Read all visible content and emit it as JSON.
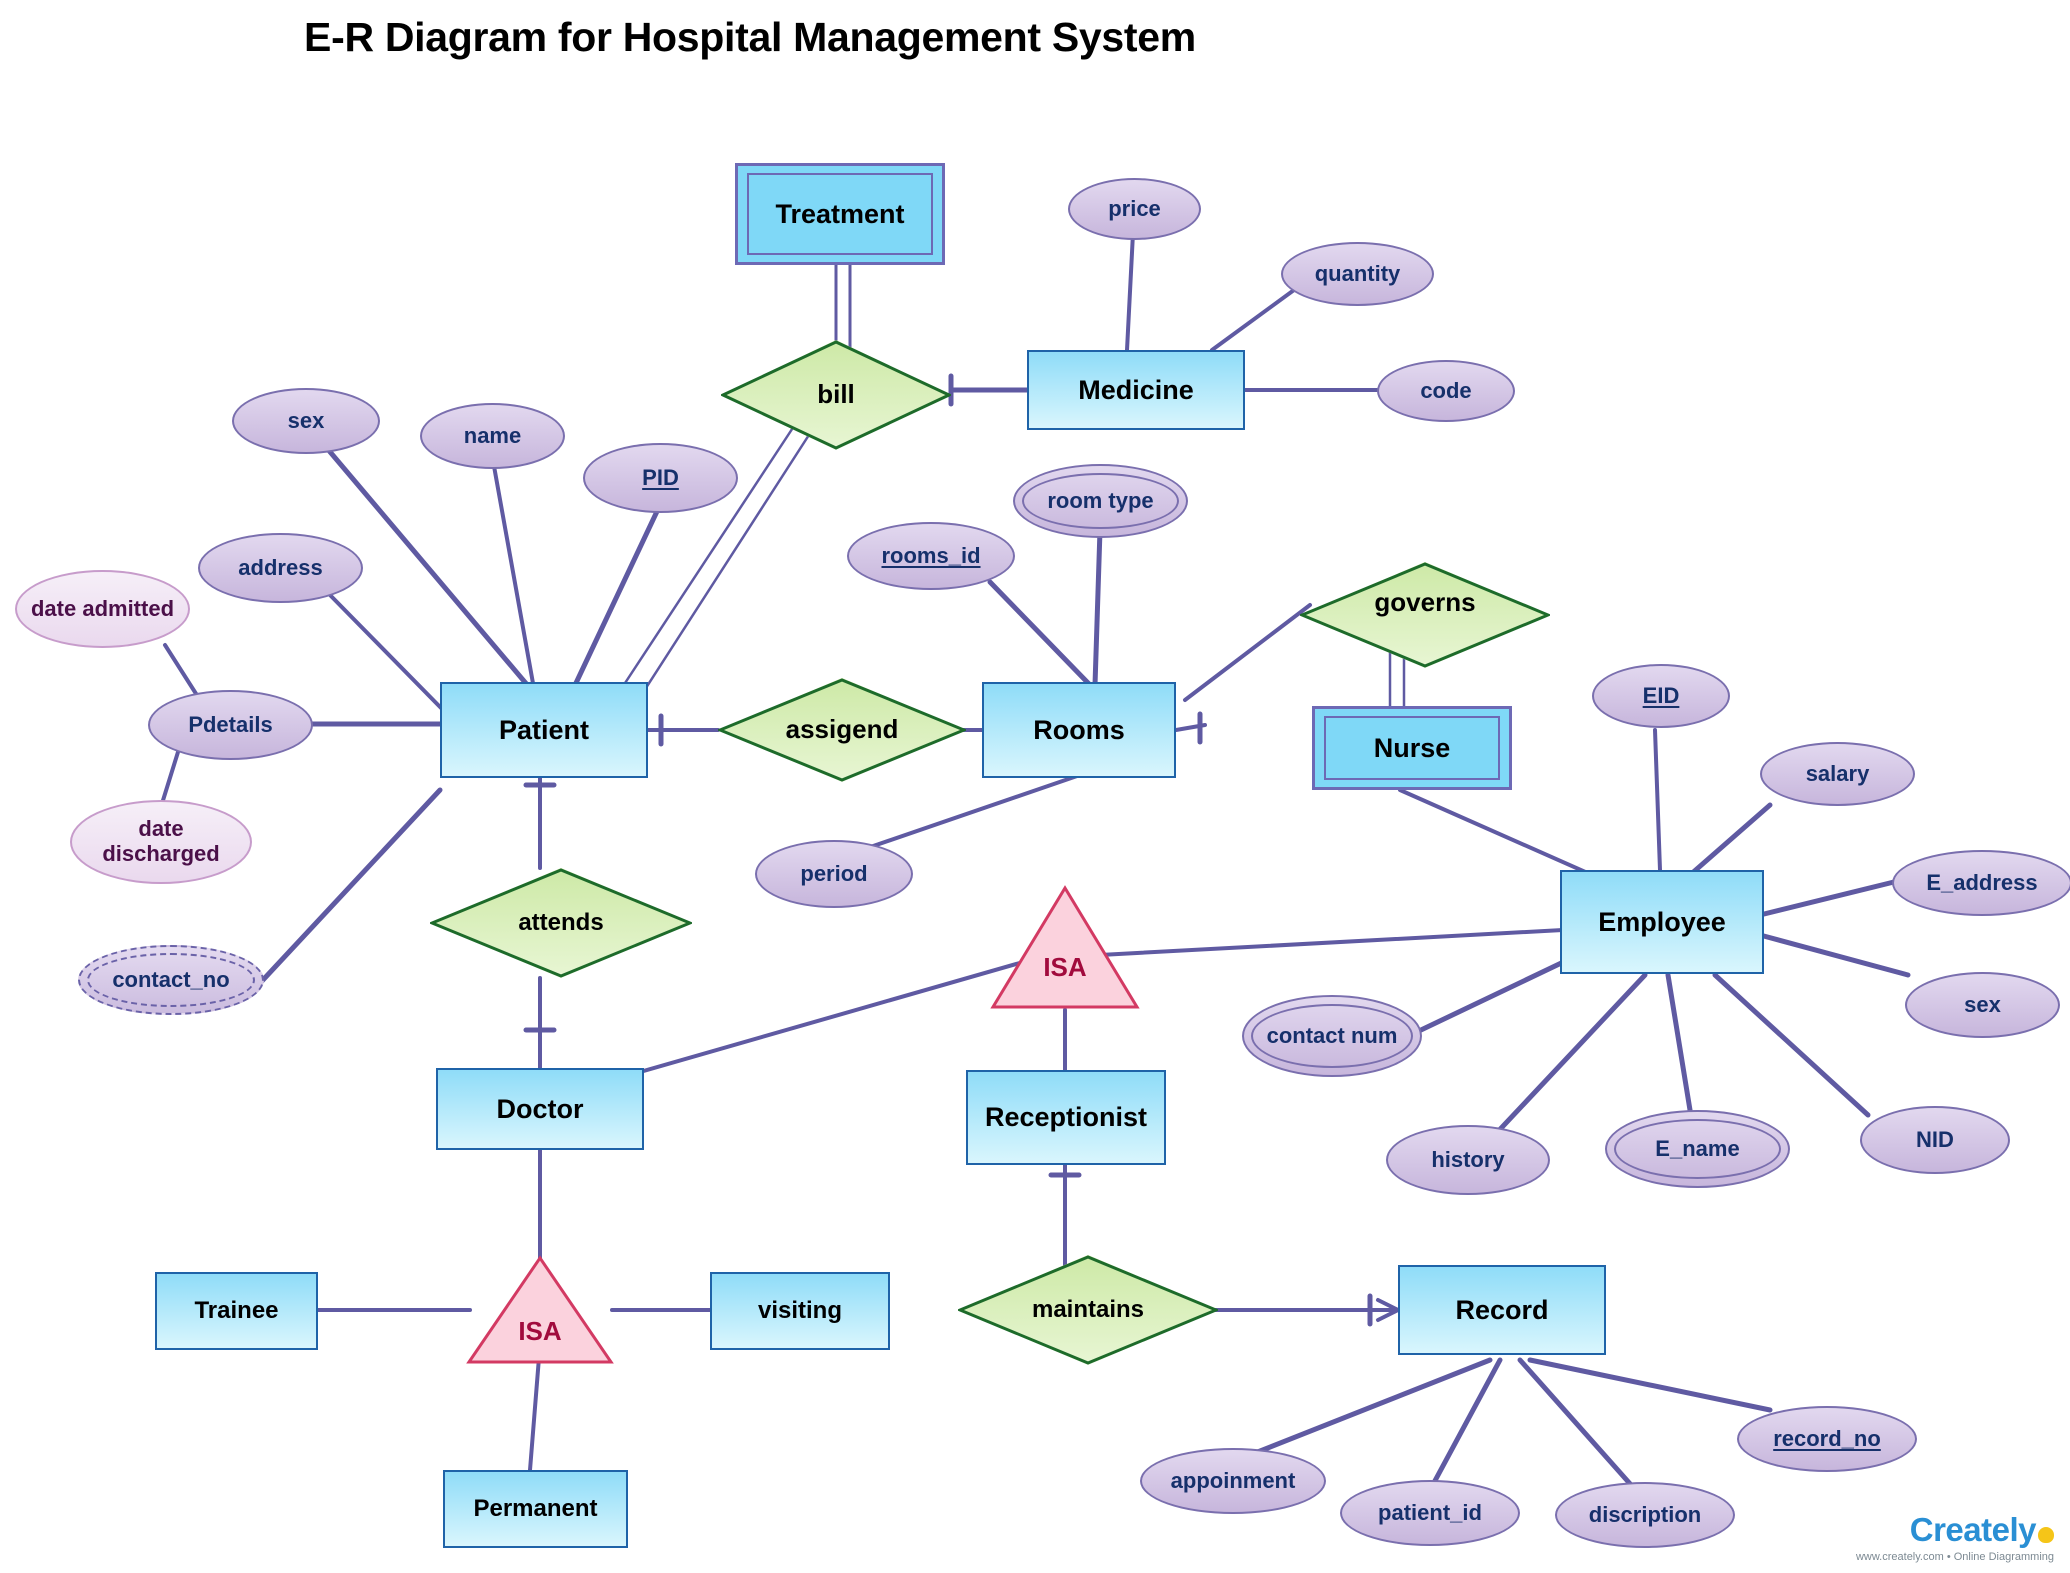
{
  "title": "E-R Diagram for Hospital Management System",
  "entities": [
    {
      "id": "treatment",
      "label": "Treatment",
      "kind": "weak"
    },
    {
      "id": "medicine",
      "label": "Medicine",
      "kind": "strong"
    },
    {
      "id": "patient",
      "label": "Patient",
      "kind": "strong"
    },
    {
      "id": "rooms",
      "label": "Rooms",
      "kind": "strong"
    },
    {
      "id": "nurse",
      "label": "Nurse",
      "kind": "weak"
    },
    {
      "id": "employee",
      "label": "Employee",
      "kind": "strong"
    },
    {
      "id": "doctor",
      "label": "Doctor",
      "kind": "strong"
    },
    {
      "id": "receptionist",
      "label": "Receptionist",
      "kind": "strong"
    },
    {
      "id": "record",
      "label": "Record",
      "kind": "strong"
    },
    {
      "id": "trainee",
      "label": "Trainee",
      "kind": "strong"
    },
    {
      "id": "visiting",
      "label": "visiting",
      "kind": "strong"
    },
    {
      "id": "permanent",
      "label": "Permanent",
      "kind": "strong"
    }
  ],
  "relationships": [
    {
      "id": "bill",
      "label": "bill"
    },
    {
      "id": "assigend",
      "label": "assigend"
    },
    {
      "id": "governs",
      "label": "governs"
    },
    {
      "id": "attends",
      "label": "attends"
    },
    {
      "id": "maintains",
      "label": "maintains"
    }
  ],
  "isa_nodes": [
    {
      "id": "isa-doctor",
      "label": "ISA"
    },
    {
      "id": "isa-receptionist",
      "label": "ISA"
    }
  ],
  "attributes": [
    {
      "id": "price",
      "label": "price",
      "owner": "medicine",
      "type": "simple"
    },
    {
      "id": "quantity",
      "label": "quantity",
      "owner": "medicine",
      "type": "simple"
    },
    {
      "id": "code",
      "label": "code",
      "owner": "medicine",
      "type": "simple"
    },
    {
      "id": "sex-patient",
      "label": "sex",
      "owner": "patient",
      "type": "simple"
    },
    {
      "id": "name",
      "label": "name",
      "owner": "patient",
      "type": "simple"
    },
    {
      "id": "pid",
      "label": "PID",
      "owner": "patient",
      "type": "key"
    },
    {
      "id": "address",
      "label": "address",
      "owner": "patient",
      "type": "simple"
    },
    {
      "id": "pdetails",
      "label": "Pdetails",
      "owner": "patient",
      "type": "composite"
    },
    {
      "id": "date-admitted",
      "label": "date admitted",
      "owner": "pdetails",
      "type": "component"
    },
    {
      "id": "date-discharged",
      "label": "date discharged",
      "owner": "pdetails",
      "type": "component"
    },
    {
      "id": "contact-no",
      "label": "contact_no",
      "owner": "patient",
      "type": "multivalued-dashed"
    },
    {
      "id": "rooms-id",
      "label": "rooms_id",
      "owner": "rooms",
      "type": "key"
    },
    {
      "id": "room-type",
      "label": "room type",
      "owner": "rooms",
      "type": "multivalued"
    },
    {
      "id": "period",
      "label": "period",
      "owner": "rooms",
      "type": "simple"
    },
    {
      "id": "eid",
      "label": "EID",
      "owner": "employee",
      "type": "key"
    },
    {
      "id": "salary",
      "label": "salary",
      "owner": "employee",
      "type": "simple"
    },
    {
      "id": "e-address",
      "label": "E_address",
      "owner": "employee",
      "type": "simple"
    },
    {
      "id": "sex-employee",
      "label": "sex",
      "owner": "employee",
      "type": "simple"
    },
    {
      "id": "nid",
      "label": "NID",
      "owner": "employee",
      "type": "simple"
    },
    {
      "id": "e-name",
      "label": "E_name",
      "owner": "employee",
      "type": "multivalued"
    },
    {
      "id": "history",
      "label": "history",
      "owner": "employee",
      "type": "simple"
    },
    {
      "id": "contact-num",
      "label": "contact num",
      "owner": "employee",
      "type": "multivalued"
    },
    {
      "id": "appoinment",
      "label": "appoinment",
      "owner": "record",
      "type": "simple"
    },
    {
      "id": "patient-id",
      "label": "patient_id",
      "owner": "record",
      "type": "simple"
    },
    {
      "id": "discription",
      "label": "discription",
      "owner": "record",
      "type": "simple"
    },
    {
      "id": "record-no",
      "label": "record_no",
      "owner": "record",
      "type": "key"
    }
  ],
  "brand": {
    "name": "Creately",
    "tagline": "www.creately.com • Online Diagramming"
  },
  "colors": {
    "entity_border": "#1f63a8",
    "entity_fill": "#8fdcf8",
    "relationship_fill": "#cde9a6",
    "relationship_border": "#1d6b2a",
    "attribute_fill": "#c7b6dc",
    "attribute_border": "#7a6fae",
    "isa_fill": "#fbd2dd",
    "isa_border": "#d33a63",
    "line": "#5f5aa2",
    "text": "#16306b"
  }
}
